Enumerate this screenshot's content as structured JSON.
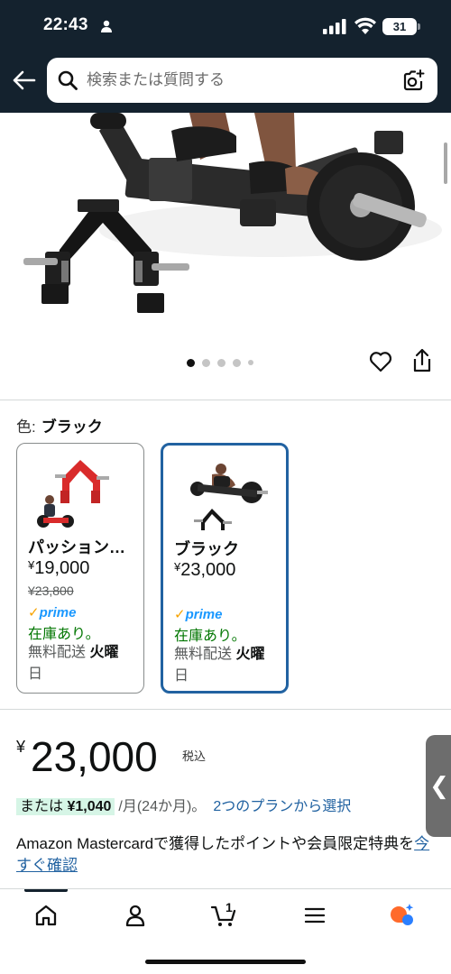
{
  "status_bar": {
    "time": "22:43",
    "battery": "31"
  },
  "header": {
    "search_placeholder": "検索または質問する"
  },
  "carousel": {
    "total_dots": 5,
    "active_index": 0
  },
  "color_section": {
    "label": "色:",
    "selected": "ブラック",
    "variants": [
      {
        "name": "パッション…",
        "price_symbol": "¥",
        "price": "19,000",
        "old_price": "¥23,800",
        "prime": "prime",
        "stock": "在庫あり。",
        "ship_prefix": "無料配送 ",
        "ship_day": "火曜",
        "ship_suffix": "日",
        "selected": false
      },
      {
        "name": "ブラック",
        "price_symbol": "¥",
        "price": "23,000",
        "old_price": "",
        "prime": "prime",
        "stock": "在庫あり。",
        "ship_prefix": "無料配送 ",
        "ship_day": "火曜",
        "ship_suffix": "日",
        "selected": true
      }
    ]
  },
  "price_section": {
    "currency": "¥",
    "amount": "23,000",
    "tax_note": "税込",
    "installment_prefix": "または",
    "installment_amount": "¥1,040",
    "installment_period": "/月(24か月)。",
    "plan_link": "2つのプランから選択",
    "card_text": "Amazon Mastercardで獲得したポイントや会員限定特典を",
    "card_link": "今すぐ確認"
  },
  "side_tab": {
    "glyph": "❮"
  },
  "bottom_nav": {
    "cart_count": "1"
  },
  "colors": {
    "header_bg": "#14222e",
    "link": "#2162a1",
    "stock_green": "#007600",
    "selected_border": "#2162a1",
    "prime_blue": "#1a98ff"
  }
}
